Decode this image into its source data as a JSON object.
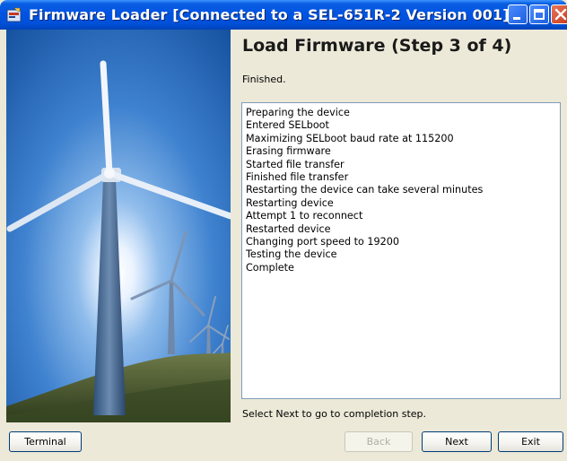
{
  "window": {
    "title": "Firmware Loader [Connected to a SEL-651R-2 Version 001]",
    "icon": "firmware-loader-app-icon"
  },
  "titlebar_buttons": {
    "minimize": "minimize-icon",
    "maximize": "maximize-icon",
    "close": "close-icon"
  },
  "side_image": {
    "subject": "wind turbines against sunlit blue sky",
    "icon": "wind-turbine-illustration"
  },
  "content": {
    "heading": "Load Firmware (Step 3 of 4)",
    "status": "Finished.",
    "log_lines": [
      "Preparing the device",
      "Entered SELboot",
      "Maximizing SELboot baud rate at 115200",
      "Erasing firmware",
      "Started file transfer",
      "Finished file transfer",
      "Restarting the device can take several minutes",
      "Restarting device",
      "Attempt 1 to reconnect",
      "Restarted device",
      "Changing port speed to 19200",
      "Testing the device",
      "Complete"
    ],
    "hint": "Select Next to go to completion step."
  },
  "buttons": {
    "terminal": "Terminal",
    "back": "Back",
    "next": "Next",
    "exit": "Exit"
  },
  "colors": {
    "titlebar": "#0054E3",
    "window_bg": "#ECE9D8",
    "sky": "#1C5FB0",
    "button_border": "#003C74"
  }
}
